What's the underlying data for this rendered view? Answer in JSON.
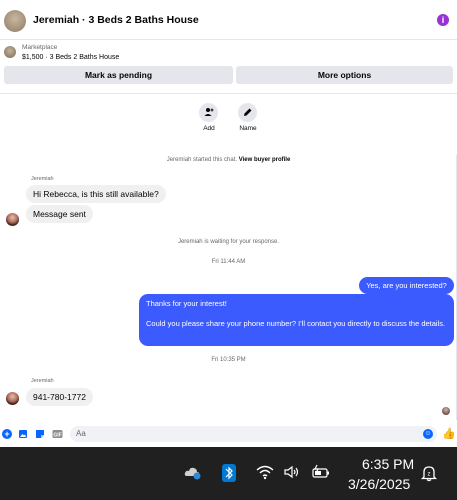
{
  "header": {
    "title": "Jeremiah · 3 Beds 2 Baths House",
    "info_icon": "info-icon"
  },
  "listing": {
    "label": "Marketplace",
    "title": "$1,500 · 3 Beds 2 Baths House"
  },
  "buttons": {
    "mark_pending": "Mark as pending",
    "more_options": "More options"
  },
  "actions": {
    "add_label": "Add",
    "name_label": "Name"
  },
  "system": {
    "started_prefix": "Jeremiah started this chat. ",
    "view_profile": "View buyer profile",
    "waiting": "Jeremiah is waiting for your response.",
    "ts1": "Fri 11:44 AM",
    "ts2": "Fri 10:35 PM"
  },
  "messages": {
    "sender1": "Jeremiah",
    "in1": "Hi Rebecca, is this still available?",
    "in2": "Message sent",
    "out1": "Yes, are you interested?",
    "out2_line1": "Thanks for your interest!",
    "out2_line2": "Could you please share your phone number? I'll contact you directly to discuss the details.",
    "sender2": "Jeremiah",
    "in3": "941-780-1772"
  },
  "composer": {
    "placeholder": "Aa"
  },
  "taskbar": {
    "time": "6:35 PM",
    "date": "3/26/2025"
  },
  "colors": {
    "accent": "#0866ff",
    "outgoing_bubble": "#3b5bff",
    "taskbar": "#202020"
  }
}
